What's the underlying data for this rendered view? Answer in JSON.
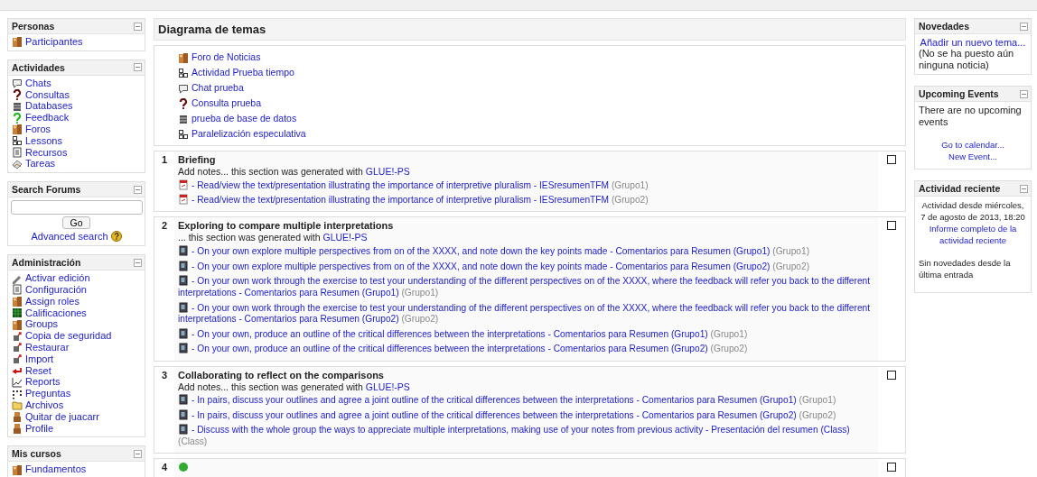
{
  "left_blocks": [
    {
      "title": "Personas",
      "items": [
        {
          "kind": "forum",
          "label": "Participantes"
        }
      ]
    },
    {
      "title": "Actividades",
      "items": [
        {
          "kind": "chat",
          "label": "Chats"
        },
        {
          "kind": "question",
          "label": "Consultas"
        },
        {
          "kind": "database",
          "label": "Databases"
        },
        {
          "kind": "feedback",
          "label": "Feedback"
        },
        {
          "kind": "forum",
          "label": "Foros"
        },
        {
          "kind": "lesson",
          "label": "Lessons"
        },
        {
          "kind": "resource",
          "label": "Recursos"
        },
        {
          "kind": "assignment",
          "label": "Tareas"
        }
      ]
    },
    {
      "title": "Search Forums",
      "search": {
        "button": "Go",
        "link": "Advanced search"
      }
    },
    {
      "title": "Administración",
      "items": [
        {
          "kind": "edit",
          "label": "Activar edición"
        },
        {
          "kind": "resource",
          "label": "Configuración"
        },
        {
          "kind": "forum",
          "label": "Assign roles"
        },
        {
          "kind": "grades",
          "label": "Calificaciones"
        },
        {
          "kind": "forum",
          "label": "Groups"
        },
        {
          "kind": "backup",
          "label": "Copia de seguridad"
        },
        {
          "kind": "backup",
          "label": "Restaurar"
        },
        {
          "kind": "backup",
          "label": "Import"
        },
        {
          "kind": "reset",
          "label": "Reset"
        },
        {
          "kind": "reports",
          "label": "Reports"
        },
        {
          "kind": "questions",
          "label": "Preguntas"
        },
        {
          "kind": "files",
          "label": "Archivos"
        },
        {
          "kind": "person",
          "label": "Quitar de juacarr"
        },
        {
          "kind": "person",
          "label": "Profile"
        }
      ]
    },
    {
      "title": "Mis cursos",
      "items": [
        {
          "kind": "course",
          "label": "Fundamentos"
        }
      ]
    }
  ],
  "main": {
    "title": "Diagrama de temas",
    "intro": [
      {
        "kind": "forum",
        "label": "Foro de Noticias"
      },
      {
        "kind": "lesson",
        "label": "Actividad Prueba tiempo"
      },
      {
        "kind": "chat",
        "label": "Chat prueba"
      },
      {
        "kind": "question",
        "label": "Consulta prueba"
      },
      {
        "kind": "database",
        "label": "prueba de base de datos"
      },
      {
        "kind": "lesson",
        "label": "Paralelización especulativa"
      }
    ],
    "sections": [
      {
        "number": "1",
        "title": "Briefing",
        "summary": "Add notes... this section was generated with ",
        "summary_link": "GLUE!-PS",
        "items": [
          {
            "kind": "pdf",
            "label": "- Read/view the text/presentation illustrating the importance of interpretive pluralism - IESresumenTFM",
            "group": "(Grupo1)"
          },
          {
            "kind": "pdf",
            "label": "- Read/view the text/presentation illustrating the importance of interpretive pluralism - IESresumenTFM",
            "group": "(Grupo2)"
          }
        ]
      },
      {
        "number": "2",
        "title": "Exploring to compare multiple interpretations",
        "summary": "... this section was generated with ",
        "summary_link": "GLUE!-PS",
        "items": [
          {
            "kind": "page",
            "label": "- On your own explore multiple perspectives from on of the XXXX, and note down the key points made - Comentarios para Resumen (Grupo1)",
            "group": "(Grupo1)"
          },
          {
            "kind": "page",
            "label": "- On your own explore multiple perspectives from on of the XXXX, and note down the key points made - Comentarios para Resumen (Grupo2)",
            "group": "(Grupo2)"
          },
          {
            "kind": "page",
            "label": "- On your own work through the exercise to test your understanding of the different perspectives on of the XXXX, where the feedback will refer you back to the different interpretations - Comentarios para Resumen (Grupo1)",
            "group": "(Grupo1)"
          },
          {
            "kind": "page",
            "label": "- On your own work through the exercise to test your understanding of the different perspectives on of the XXXX, where the feedback will refer you back to the different interpretations - Comentarios para Resumen (Grupo2)",
            "group": "(Grupo2)"
          },
          {
            "kind": "page",
            "label": "- On your own, produce an outline of the critical differences between the interpretations - Comentarios para Resumen (Grupo1)",
            "group": "(Grupo1)"
          },
          {
            "kind": "page",
            "label": "- On your own, produce an outline of the critical differences between the interpretations - Comentarios para Resumen (Grupo2)",
            "group": "(Grupo2)"
          }
        ]
      },
      {
        "number": "3",
        "title": "Collaborating to reflect on the comparisons",
        "summary": "Add notes... this section was generated with ",
        "summary_link": "GLUE!-PS",
        "items": [
          {
            "kind": "page",
            "label": "- In pairs, discuss your outlines and agree a joint outline of the critical differences between the interpretations - Comentarios para Resumen (Grupo1)",
            "group": "(Grupo1)"
          },
          {
            "kind": "page",
            "label": "- In pairs, discuss your outlines and agree a joint outline of the critical differences between the interpretations - Comentarios para Resumen (Grupo2)",
            "group": "(Grupo2)"
          },
          {
            "kind": "page",
            "label": "- Discuss with the whole group the ways to appreciate multiple interpretations, making use of your notes from previous activity - Presentación del resumen (Class)",
            "group": "(Class)"
          }
        ]
      },
      {
        "number": "4"
      }
    ]
  },
  "right_blocks": [
    {
      "title": "Novedades",
      "link": "Añadir un nuevo tema...",
      "text": "(No se ha puesto aún ninguna noticia)"
    },
    {
      "title": "Upcoming Events",
      "text": "There are no upcoming events",
      "links": [
        "Go to calendar...",
        "New Event..."
      ]
    },
    {
      "title": "Actividad reciente",
      "centered": "Actividad desde miércoles, 7 de agosto de 2013, 18:20",
      "link": "Informe completo de la actividad reciente",
      "text": "Sin novedades desde la última entrada"
    }
  ]
}
